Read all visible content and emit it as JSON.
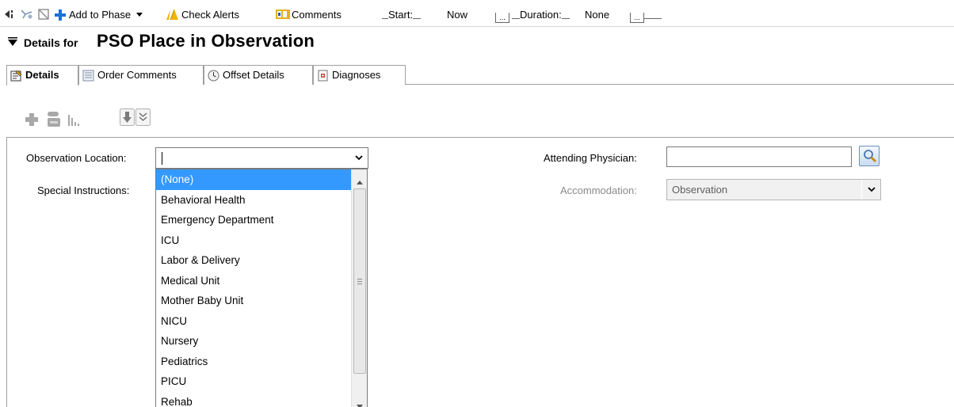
{
  "toolbar": {
    "add_to_phase": "Add to Phase",
    "check_alerts": "Check Alerts",
    "comments": "Comments",
    "start_label": "Start:",
    "start_value": "Now",
    "duration_label": "Duration:",
    "duration_value": "None",
    "ellipsis": "..."
  },
  "header": {
    "prefix": "Details for",
    "title": "PSO Place in Observation"
  },
  "tabs": [
    {
      "label": "Details",
      "active": true
    },
    {
      "label": "Order Comments",
      "active": false
    },
    {
      "label": "Offset Details",
      "active": false
    },
    {
      "label": "Diagnoses",
      "active": false
    }
  ],
  "form": {
    "observation_location_label": "Observation Location:",
    "observation_location_value": "",
    "special_instructions_label": "Special Instructions:",
    "attending_physician_label": "Attending Physician:",
    "attending_physician_value": "",
    "accommodation_label": "Accommodation:",
    "accommodation_value": "Observation"
  },
  "dropdown": {
    "selected_index": 0,
    "options": [
      "(None)",
      "Behavioral Health",
      "Emergency Department",
      "ICU",
      "Labor & Delivery",
      "Medical Unit",
      "Mother Baby Unit",
      "NICU",
      "Nursery",
      "Pediatrics",
      "PICU",
      "Rehab"
    ]
  },
  "colors": {
    "selection": "#3399ff",
    "accent_blue": "#1f6fd6",
    "alert_yellow": "#f2b300"
  },
  "icons": [
    "back-icon",
    "pin-icon",
    "no-entry-icon",
    "plus-icon",
    "alert-icon",
    "comments-icon",
    "dropdown-caret-icon",
    "search-icon",
    "add-icon",
    "pill-icon",
    "bar-chart-icon",
    "move-down-icon",
    "expand-icon"
  ]
}
